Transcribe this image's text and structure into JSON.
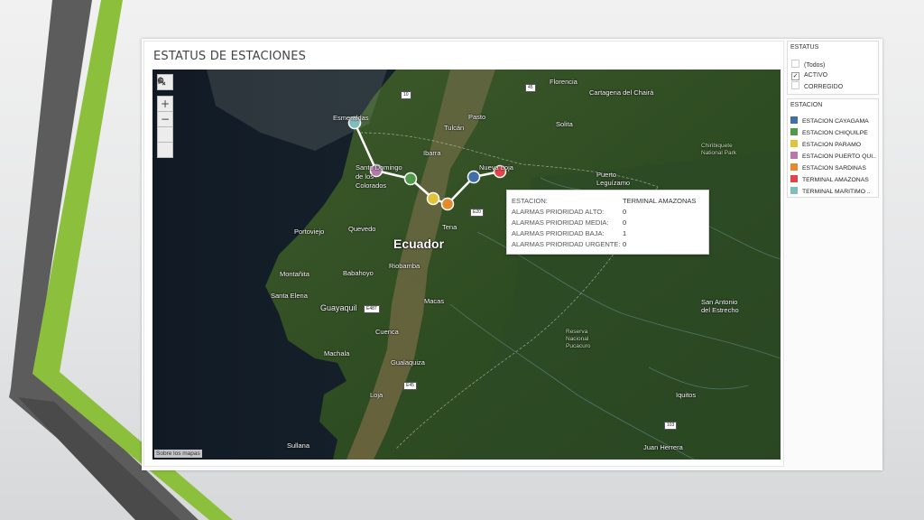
{
  "dashboard": {
    "title": "ESTATUS DE ESTACIONES",
    "map_attribution": "Sobre los mapas"
  },
  "map_controls": {
    "search_icon": "magnifier-icon",
    "zoom_in": "+",
    "zoom_out": "−",
    "reset_icon": "pan-reset-icon",
    "expand_icon": "triangle-right-icon"
  },
  "map": {
    "country_label": "Ecuador",
    "places": [
      "Florencia",
      "Cartagena del Chairá",
      "Pasto",
      "Tulcán",
      "Esmeraldas",
      "Ibarra",
      "Santo Domingo de los Colorados",
      "Nueva Loja",
      "Puerto Leguízamo",
      "Solita",
      "Portoviejo",
      "Quevedo",
      "Riobamba",
      "Montañita",
      "Babahoyo",
      "Santa Elena",
      "Guayaquil",
      "Macas",
      "Tena",
      "Cuenca",
      "Machala",
      "Gualaquiza",
      "Loja",
      "Sullana",
      "Iquitos",
      "Juan Herrera",
      "San Antonio del Estrecho",
      "Reserva Nacional Pucacuro",
      "Chiribiquete National Park"
    ],
    "shields": [
      "10",
      "45",
      "E20",
      "E487",
      "E45",
      "103"
    ],
    "route_colors": {
      "line": "#ffffff"
    }
  },
  "tooltip": {
    "rows": [
      {
        "label": "ESTACION:",
        "value": "TERMINAL AMAZONAS"
      },
      {
        "label": "ALARMAS PRIORIDAD  ALTO:",
        "value": "0"
      },
      {
        "label": "ALARMAS PRIORIDAD MEDIA:",
        "value": "0"
      },
      {
        "label": "ALARMAS PRIORIDAD BAJA:",
        "value": "1"
      },
      {
        "label": "ALARMAS PRIORIDAD URGENTE:",
        "value": "0"
      }
    ]
  },
  "filter": {
    "title": "ESTATUS",
    "options": [
      {
        "label": "(Todos)",
        "checked": false
      },
      {
        "label": "ACTIVO",
        "checked": true
      },
      {
        "label": "CORREGIDO",
        "checked": false
      }
    ]
  },
  "legend": {
    "title": "ESTACION",
    "items": [
      {
        "label": "ESTACION CAYAGAMA",
        "color": "#3f6ea8"
      },
      {
        "label": "ESTACION CHIQUILPE",
        "color": "#4e9a4a"
      },
      {
        "label": "ESTACION PARAMO",
        "color": "#e0c33a"
      },
      {
        "label": "ESTACION PUERTO QUI..",
        "color": "#b67aa8"
      },
      {
        "label": "ESTACION SARDINAS",
        "color": "#e68a2e"
      },
      {
        "label": "TERMINAL AMAZONAS",
        "color": "#e0454a"
      },
      {
        "label": "TERMINAL MARITIMO ..",
        "color": "#7fbcbc"
      }
    ]
  }
}
